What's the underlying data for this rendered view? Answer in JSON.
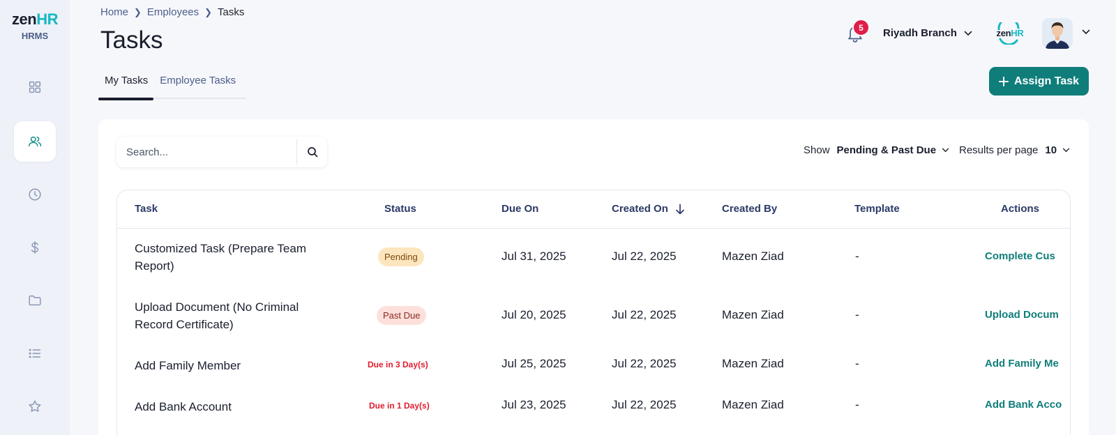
{
  "brand": {
    "logo_main": "zen",
    "logo_accent": "HR",
    "logo_sub": "HRMS",
    "mini_main": "zen",
    "mini_accent": "HR"
  },
  "sidebar": {
    "items": [
      {
        "name": "dashboard",
        "icon": "grid-icon",
        "active": false
      },
      {
        "name": "employees",
        "icon": "users-icon",
        "active": true
      },
      {
        "name": "time",
        "icon": "clock-icon",
        "active": false
      },
      {
        "name": "payroll",
        "icon": "dollar-icon",
        "active": false
      },
      {
        "name": "documents",
        "icon": "folder-icon",
        "active": false
      },
      {
        "name": "lists",
        "icon": "list-icon",
        "active": false
      },
      {
        "name": "favorites",
        "icon": "star-icon",
        "active": false
      }
    ]
  },
  "breadcrumb": {
    "home": "Home",
    "employees": "Employees",
    "current": "Tasks"
  },
  "page": {
    "title": "Tasks"
  },
  "tabs": {
    "my_tasks": "My Tasks",
    "employee_tasks": "Employee Tasks"
  },
  "header": {
    "notification_count": "5",
    "branch": "Riyadh Branch"
  },
  "assign_button": {
    "label": "Assign Task"
  },
  "search": {
    "placeholder": "Search..."
  },
  "filters": {
    "show_label": "Show",
    "show_value": "Pending & Past Due",
    "per_page_label": "Results per page",
    "per_page_value": "10"
  },
  "table": {
    "columns": {
      "task": "Task",
      "status": "Status",
      "due_on": "Due On",
      "created_on": "Created On",
      "created_by": "Created By",
      "template": "Template",
      "actions": "Actions"
    },
    "rows": [
      {
        "task": "Customized Task (Prepare Team Report)",
        "status": "Pending",
        "due_on": "Jul 31, 2025",
        "created_on": "Jul 22, 2025",
        "created_by": "Mazen Ziad",
        "template": "-",
        "action": "Complete Cus"
      },
      {
        "task": "Upload Document (No Criminal Record Certificate)",
        "status": "Past Due",
        "due_on": "Jul 20, 2025",
        "created_on": "Jul 22, 2025",
        "created_by": "Mazen Ziad",
        "template": "-",
        "action": "Upload Docum"
      },
      {
        "task": "Add Family Member",
        "status": "Due in 3 Day(s)",
        "due_on": "Jul 25, 2025",
        "created_on": "Jul 22, 2025",
        "created_by": "Mazen Ziad",
        "template": "-",
        "action": "Add Family Me"
      },
      {
        "task": "Add Bank Account",
        "status": "Due in 1 Day(s)",
        "due_on": "Jul 23, 2025",
        "created_on": "Jul 22, 2025",
        "created_by": "Mazen Ziad",
        "template": "-",
        "action": "Add Bank Acco"
      }
    ]
  },
  "colors": {
    "accent": "#0f7e7a",
    "brand_cyan": "#16b9c2",
    "danger": "#e11d2e",
    "nav_bg": "#eef1f8"
  }
}
